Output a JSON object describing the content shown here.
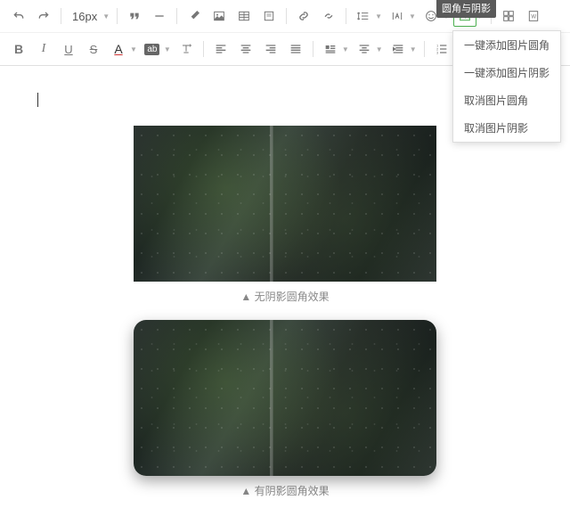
{
  "toolbar": {
    "fontsize": "16px",
    "tooltip": "圆角与阴影"
  },
  "menu": {
    "items": [
      "一键添加图片圆角",
      "一键添加图片阴影",
      "取消图片圆角",
      "取消图片阴影"
    ]
  },
  "captions": {
    "plain": "▲ 无阴影圆角效果",
    "styled": "▲ 有阴影圆角效果"
  },
  "labels": {
    "bold": "B",
    "italic": "I",
    "underline": "U",
    "strike": "S",
    "fontcolor": "A",
    "bgcolor": "ab"
  }
}
